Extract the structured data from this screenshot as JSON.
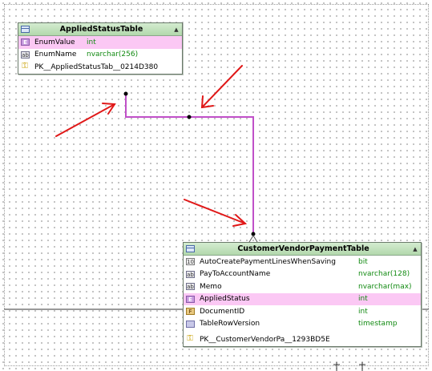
{
  "table_a": {
    "title": "AppliedStatusTable",
    "columns": [
      {
        "name": "EnumValue",
        "type": "int",
        "icon": "enum-icon",
        "selected": true
      },
      {
        "name": "EnumName",
        "type": "nvarchar(256)",
        "icon": "string-icon",
        "selected": false
      }
    ],
    "key": "PK__AppliedStatusTab__0214D380"
  },
  "table_b": {
    "title": "CustomerVendorPaymentTable",
    "columns": [
      {
        "name": "AutoCreatePaymentLinesWhenSaving",
        "type": "bit",
        "icon": "bit-icon",
        "selected": false
      },
      {
        "name": "PayToAccountName",
        "type": "nvarchar(128)",
        "icon": "string-icon",
        "selected": false
      },
      {
        "name": "Memo",
        "type": "nvarchar(max)",
        "icon": "string-icon",
        "selected": false
      },
      {
        "name": "AppliedStatus",
        "type": "int",
        "icon": "enum-icon",
        "selected": true
      },
      {
        "name": "DocumentID",
        "type": "int",
        "icon": "foreign-key-icon",
        "selected": false
      },
      {
        "name": "TableRowVersion",
        "type": "timestamp",
        "icon": "timestamp-icon",
        "selected": false
      }
    ],
    "key": "PK__CustomerVendorPa__1293BD5E"
  },
  "colors": {
    "relationship_line": "#c050c8",
    "annotation_arrow": "#e01818",
    "selected_row": "#fbc8f4",
    "header": "#b2d8ac",
    "type_text": "#128a12"
  }
}
